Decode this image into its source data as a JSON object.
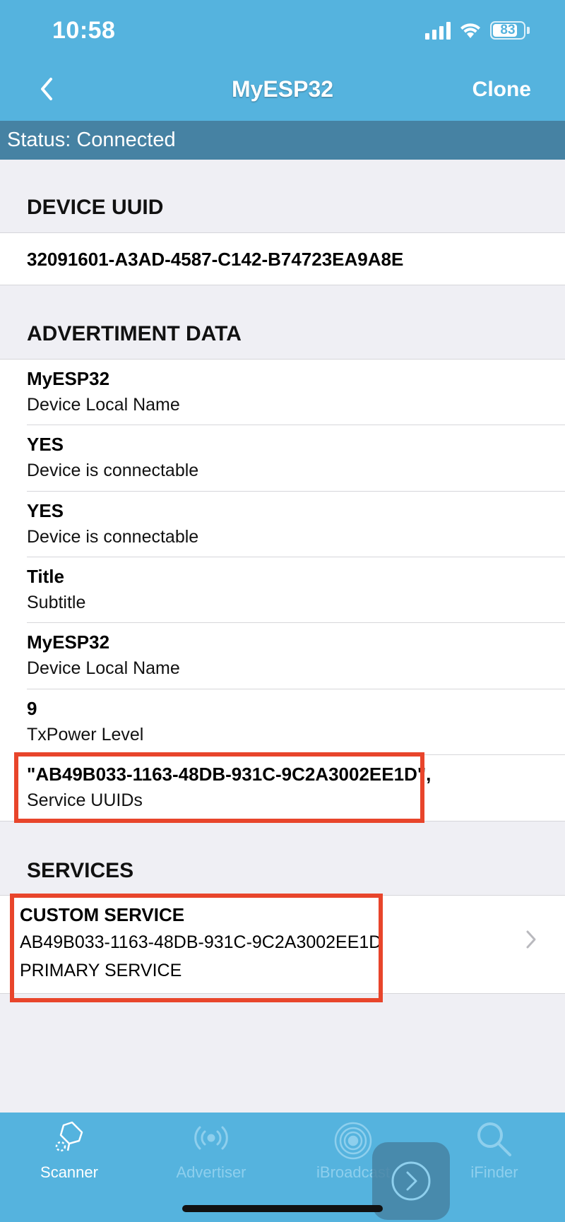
{
  "status_bar": {
    "time": "10:58",
    "battery": "83"
  },
  "nav": {
    "title": "MyESP32",
    "clone_label": "Clone"
  },
  "connection": {
    "status": "Status: Connected"
  },
  "device_uuid": {
    "header": "DEVICE UUID",
    "value": "32091601-A3AD-4587-C142-B74723EA9A8E"
  },
  "advertisement": {
    "header": "ADVERTIMENT DATA",
    "rows": [
      {
        "title": "MyESP32",
        "subtitle": "Device Local Name"
      },
      {
        "title": "YES",
        "subtitle": "Device is connectable"
      },
      {
        "title": "YES",
        "subtitle": "Device is connectable"
      },
      {
        "title": "Title",
        "subtitle": "Subtitle"
      },
      {
        "title": "MyESP32",
        "subtitle": "Device Local Name"
      },
      {
        "title": "9",
        "subtitle": "TxPower Level"
      },
      {
        "title": "\"AB49B033-1163-48DB-931C-9C2A3002EE1D\",",
        "subtitle": "Service UUIDs"
      }
    ]
  },
  "services": {
    "header": "SERVICES",
    "items": [
      {
        "name": "CUSTOM SERVICE",
        "uuid": "AB49B033-1163-48DB-931C-9C2A3002EE1D",
        "type": "PRIMARY SERVICE"
      }
    ]
  },
  "tabbar": {
    "tabs": [
      {
        "label": "Scanner",
        "icon": "scanner-icon",
        "active": true
      },
      {
        "label": "Advertiser",
        "icon": "broadcast-icon",
        "active": false
      },
      {
        "label": "iBroadcast",
        "icon": "ibroadcast-icon",
        "active": false
      },
      {
        "label": "iFinder",
        "icon": "search-icon",
        "active": false
      }
    ]
  },
  "colors": {
    "header": "#55b3de",
    "status_bar": "#4682a3",
    "highlight": "#e8452b"
  }
}
